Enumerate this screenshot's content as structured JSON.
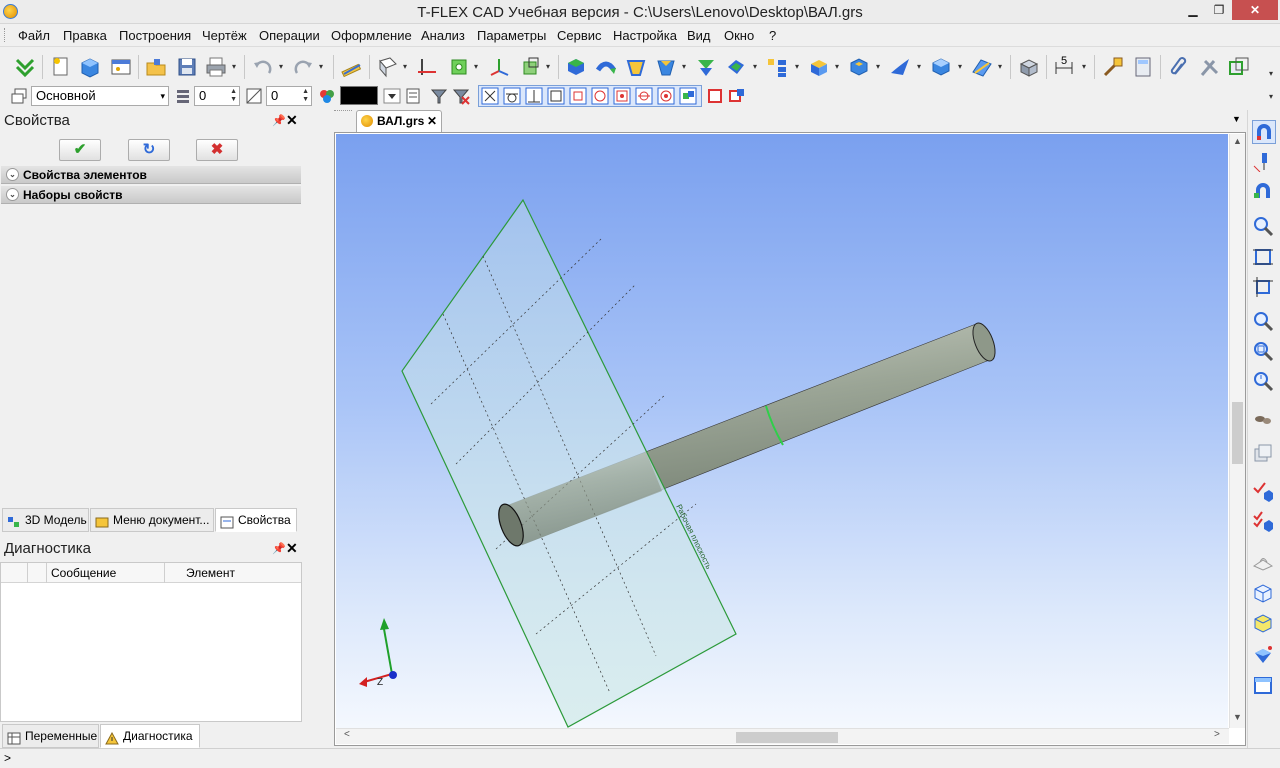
{
  "window": {
    "title": "T-FLEX CAD Учебная версия - C:\\Users\\Lenovo\\Desktop\\ВАЛ.grs",
    "min_glyph": "▁",
    "max_glyph": "❐",
    "close_glyph": "✕"
  },
  "menu": {
    "items": [
      "Файл",
      "Правка",
      "Построения",
      "Чертёж",
      "Операции",
      "Оформление",
      "Анализ",
      "Параметры",
      "Сервис",
      "Настройка",
      "Вид",
      "Окно",
      "?"
    ]
  },
  "toolbar2": {
    "layer_select": "Основной",
    "level_value": "0",
    "priority_value": "0",
    "line_color": "#000000",
    "dropdown_glyph": "▾"
  },
  "toolbar1": {
    "scale_label": "5"
  },
  "properties_panel": {
    "title": "Свойства",
    "pin_glyph": "📌",
    "close_glyph": "✕",
    "ok_glyph": "✔",
    "refresh_glyph": "↻",
    "cancel_glyph": "✖",
    "sections": [
      "Свойства элементов",
      "Наборы свойств"
    ],
    "chevron_glyph": "⌄",
    "tabs": [
      "3D Модель",
      "Меню документ...",
      "Свойства"
    ]
  },
  "diagnostics_panel": {
    "title": "Диагностика",
    "columns": [
      "Сообщение",
      "Элемент"
    ],
    "tabs": [
      "Переменные",
      "Диагностика"
    ]
  },
  "document": {
    "tab_title": "ВАЛ.grs",
    "tab_close": "✕",
    "menu_arrow": "▼"
  },
  "viewport": {
    "plane_label": "Рабочая плоскость",
    "axis_z_label": "Z"
  },
  "scrollbars": {
    "up": "▲",
    "down": "▼",
    "left": "<",
    "right": ">"
  },
  "statusbar": {
    "text": ">"
  },
  "colors": {
    "viewport_top": "#7aa0ef",
    "viewport_bottom": "#f4f8fe",
    "shaft": "#96a091",
    "plane_edge": "#2c9a3a"
  }
}
